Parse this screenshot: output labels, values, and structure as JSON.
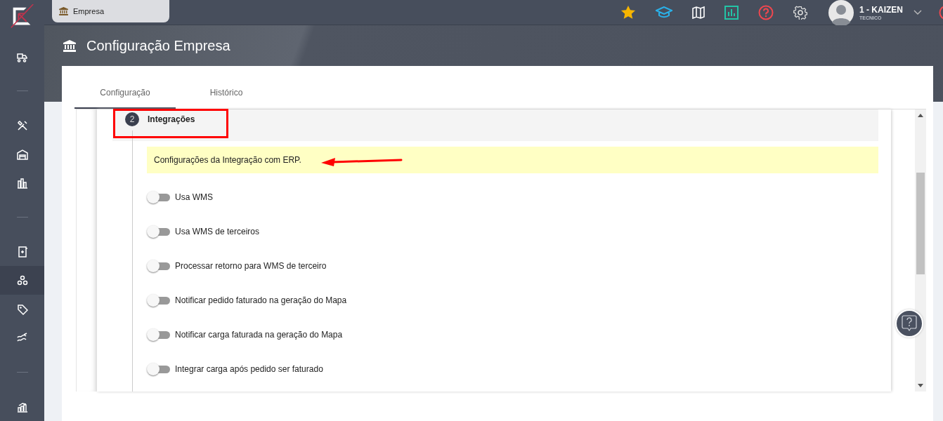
{
  "sidebar": {
    "groups": [
      [
        {
          "selected": false
        }
      ],
      [
        {
          "selected": false
        },
        {
          "selected": false
        },
        {
          "selected": false
        }
      ],
      [
        {
          "selected": false
        },
        {
          "selected": true
        },
        {
          "selected": false
        },
        {
          "selected": false
        }
      ],
      [
        {
          "selected": false
        }
      ]
    ]
  },
  "top_bar": {
    "open_tabs": [
      {
        "label": "Empresa",
        "selected": true
      }
    ],
    "user": {
      "name": "1 - KAIZEN",
      "role": "TECNICO"
    }
  },
  "page": {
    "title": "Configuração Empresa"
  },
  "tabs": [
    {
      "label": "Configuração",
      "selected": true
    },
    {
      "label": "Histórico",
      "selected": false
    }
  ],
  "step": {
    "number": "2",
    "title": "Integrações"
  },
  "note": "Configurações da Integração com ERP.",
  "settings": [
    {
      "label": "Usa WMS",
      "on": false
    },
    {
      "label": "Usa WMS de terceiros",
      "on": false
    },
    {
      "label": "Processar retorno para WMS de terceiro",
      "on": false
    },
    {
      "label": "Notificar pedido faturado na geração do Mapa",
      "on": false
    },
    {
      "label": "Notificar carga faturada na geração do Mapa",
      "on": false
    },
    {
      "label": "Integrar carga após pedido ser faturado",
      "on": false
    }
  ]
}
